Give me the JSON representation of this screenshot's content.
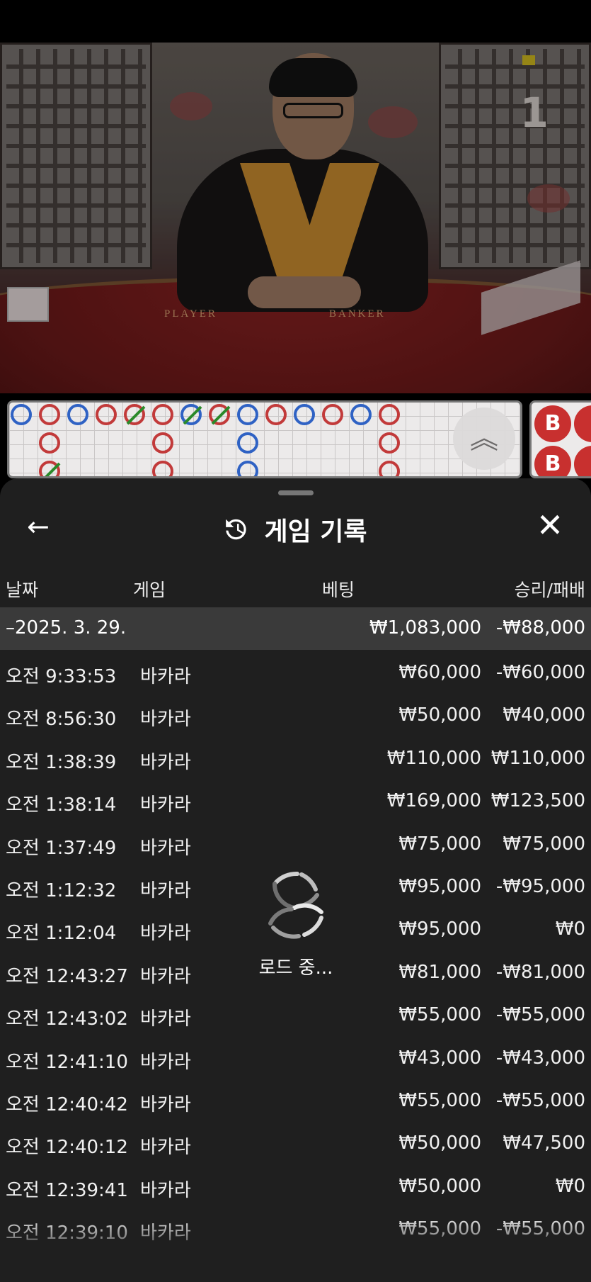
{
  "video": {
    "round_number": "1",
    "table_labels": [
      "PLAYER",
      "BANKER"
    ]
  },
  "road_map": {
    "beads": [
      {
        "col": 0,
        "row": 0,
        "result": "P",
        "tie": false
      },
      {
        "col": 1,
        "row": 0,
        "result": "B",
        "tie": false
      },
      {
        "col": 2,
        "row": 0,
        "result": "P",
        "tie": false
      },
      {
        "col": 3,
        "row": 0,
        "result": "B",
        "tie": false
      },
      {
        "col": 4,
        "row": 0,
        "result": "B",
        "tie": true
      },
      {
        "col": 5,
        "row": 0,
        "result": "B",
        "tie": false
      },
      {
        "col": 6,
        "row": 0,
        "result": "P",
        "tie": true
      },
      {
        "col": 7,
        "row": 0,
        "result": "B",
        "tie": true
      },
      {
        "col": 8,
        "row": 0,
        "result": "P",
        "tie": false
      },
      {
        "col": 9,
        "row": 0,
        "result": "B",
        "tie": false
      },
      {
        "col": 10,
        "row": 0,
        "result": "P",
        "tie": false
      },
      {
        "col": 11,
        "row": 0,
        "result": "B",
        "tie": false
      },
      {
        "col": 12,
        "row": 0,
        "result": "P",
        "tie": false
      },
      {
        "col": 13,
        "row": 0,
        "result": "B",
        "tie": false
      },
      {
        "col": 1,
        "row": 1,
        "result": "B",
        "tie": false
      },
      {
        "col": 5,
        "row": 1,
        "result": "B",
        "tie": false
      },
      {
        "col": 8,
        "row": 1,
        "result": "P",
        "tie": false
      },
      {
        "col": 13,
        "row": 1,
        "result": "B",
        "tie": false
      },
      {
        "col": 1,
        "row": 2,
        "result": "B",
        "tie": true
      },
      {
        "col": 5,
        "row": 2,
        "result": "B",
        "tie": false
      },
      {
        "col": 8,
        "row": 2,
        "result": "P",
        "tie": false
      },
      {
        "col": 13,
        "row": 2,
        "result": "B",
        "tie": false
      }
    ],
    "side_chips": [
      "B",
      "B"
    ],
    "colors": {
      "player": "#2f62c4",
      "banker": "#c23a3a",
      "tie": "#2a8a2a"
    }
  },
  "panel": {
    "title": "게임 기록",
    "icons": {
      "back": "arrow-left-icon",
      "history": "history-icon",
      "close": "close-icon"
    },
    "columns": {
      "date": "날짜",
      "game": "게임",
      "bet": "베팅",
      "result": "승리/패배"
    },
    "day_summary": {
      "date": "–2025. 3. 29.",
      "bet": "₩1,083,000",
      "result": "-₩88,000"
    },
    "rows": [
      {
        "time": "오전 9:33:53",
        "game": "바카라",
        "bet": "₩60,000",
        "result": "-₩60,000"
      },
      {
        "time": "오전 8:56:30",
        "game": "바카라",
        "bet": "₩50,000",
        "result": "₩40,000"
      },
      {
        "time": "오전 1:38:39",
        "game": "바카라",
        "bet": "₩110,000",
        "result": "₩110,000"
      },
      {
        "time": "오전 1:38:14",
        "game": "바카라",
        "bet": "₩169,000",
        "result": "₩123,500"
      },
      {
        "time": "오전 1:37:49",
        "game": "바카라",
        "bet": "₩75,000",
        "result": "₩75,000"
      },
      {
        "time": "오전 1:12:32",
        "game": "바카라",
        "bet": "₩95,000",
        "result": "-₩95,000"
      },
      {
        "time": "오전 1:12:04",
        "game": "바카라",
        "bet": "₩95,000",
        "result": "₩0"
      },
      {
        "time": "오전 12:43:27",
        "game": "바카라",
        "bet": "₩81,000",
        "result": "-₩81,000"
      },
      {
        "time": "오전 12:43:02",
        "game": "바카라",
        "bet": "₩55,000",
        "result": "-₩55,000"
      },
      {
        "time": "오전 12:41:10",
        "game": "바카라",
        "bet": "₩43,000",
        "result": "-₩43,000"
      },
      {
        "time": "오전 12:40:42",
        "game": "바카라",
        "bet": "₩55,000",
        "result": "-₩55,000"
      },
      {
        "time": "오전 12:40:12",
        "game": "바카라",
        "bet": "₩50,000",
        "result": "₩47,500"
      },
      {
        "time": "오전 12:39:41",
        "game": "바카라",
        "bet": "₩50,000",
        "result": "₩0"
      },
      {
        "time": "오전 12:39:10",
        "game": "바카라",
        "bet": "₩55,000",
        "result": "-₩55,000"
      }
    ],
    "loading_text": "로드 중..."
  }
}
